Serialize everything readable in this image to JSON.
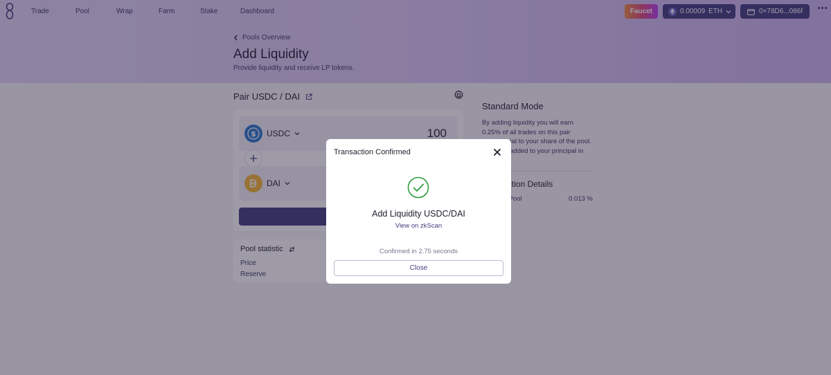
{
  "nav": {
    "items": [
      "Trade",
      "Pool",
      "Wrap",
      "Farm",
      "Stake",
      "Dashboard"
    ],
    "faucet_label": "Faucet",
    "balance": "0.00009",
    "balance_unit": "ETH",
    "wallet_address": "0×78D6...086f"
  },
  "header": {
    "back_label": "Pools Overview",
    "title": "Add Liquidity",
    "subtitle": "Provide liquidity and receive LP tokens."
  },
  "pair": {
    "label": "Pair USDC / DAI",
    "token1": {
      "symbol": "USDC",
      "amount": "100"
    },
    "token2": {
      "symbol": "DAI"
    }
  },
  "stats": {
    "title": "Pool statistic",
    "rows": [
      "Price",
      "Reserve"
    ]
  },
  "side": {
    "title": "Standard Mode",
    "text": "By adding liquidity you will earn 0.25% of all trades on this pair proportional to your share of the pool. Fees are added to your principal in",
    "details_title": "Transaction Details",
    "share_label": "Share of Pool",
    "share_value": "0.013 %"
  },
  "modal": {
    "title": "Transaction Confirmed",
    "heading": "Add Liquidity USDC/DAI",
    "link_label": "View on zkScan",
    "confirmed_text": "Confirmed in 2.75 seconds",
    "close_label": "Close"
  },
  "colors": {
    "accent": "#413b7e",
    "success": "#2e9c3c",
    "usdc": "#2775ca",
    "dai": "#f4b731"
  }
}
